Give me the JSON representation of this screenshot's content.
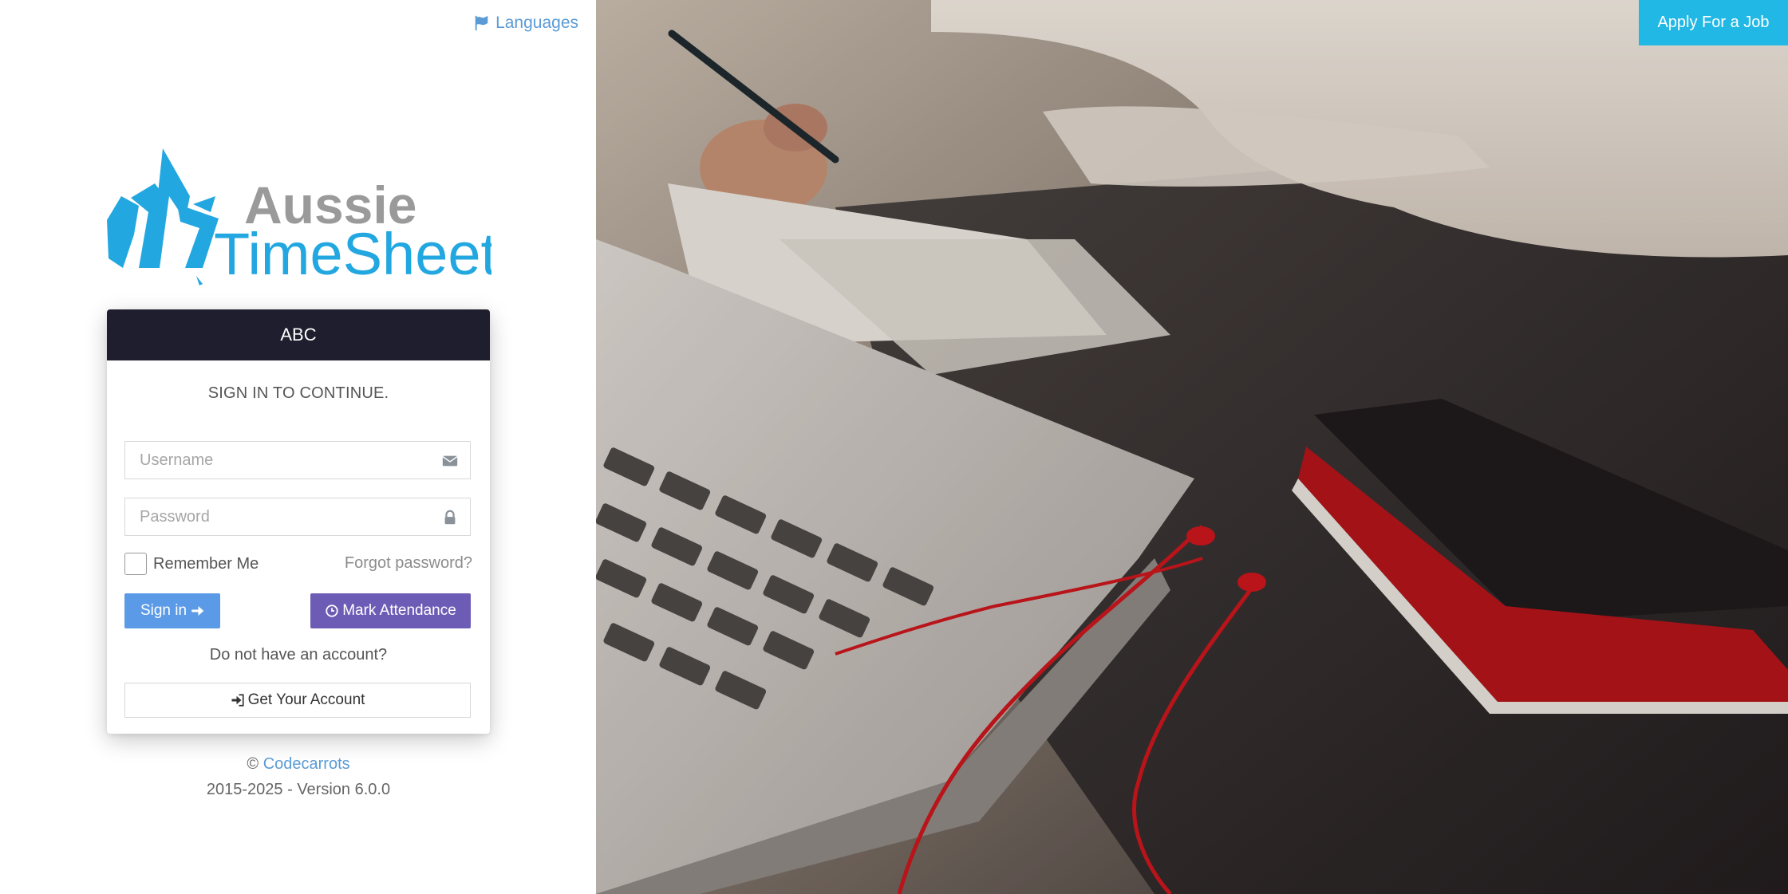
{
  "header": {
    "languages_label": "Languages",
    "apply_button": "Apply For a Job"
  },
  "logo": {
    "line1": "Aussie",
    "line2": "TimeSheets"
  },
  "card": {
    "title": "ABC",
    "signin_message": "SIGN IN TO CONTINUE.",
    "username_placeholder": "Username",
    "password_placeholder": "Password",
    "remember_label": "Remember Me",
    "forgot_label": "Forgot password?",
    "signin_button": "Sign in",
    "attendance_button": "Mark Attendance",
    "no_account_text": "Do not have an account?",
    "get_account_button": "Get Your Account"
  },
  "footer": {
    "copyright_symbol": "©",
    "company_link": "Codecarrots",
    "version_text": "2015-2025 - Version 6.0.0"
  },
  "icons": {
    "languages": "flag-icon",
    "username": "envelope-icon",
    "password": "lock-icon",
    "signin": "arrow-right-icon",
    "attendance": "clock-icon",
    "get_account": "sign-in-icon"
  },
  "colors": {
    "brand_blue": "#22a7e0",
    "brand_gray": "#9a9a9a",
    "header_dark": "#1f1e2e",
    "signin_blue": "#5b9ae6",
    "attendance_purple": "#6d5cb5",
    "apply_cyan": "#22b8e6",
    "link_blue": "#5b9bd5"
  }
}
